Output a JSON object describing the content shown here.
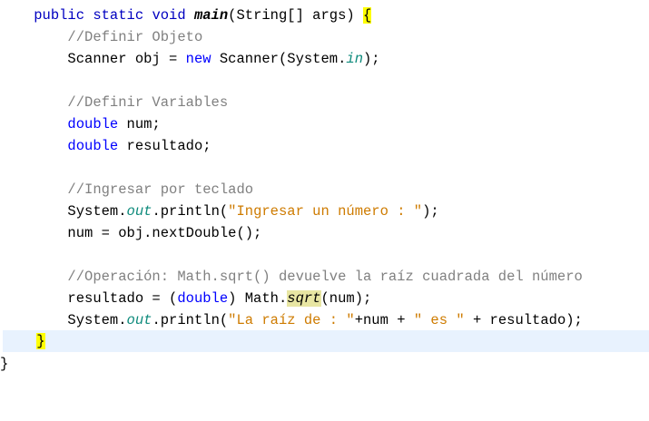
{
  "code": {
    "l1": {
      "indent": "    ",
      "mods": "public static void ",
      "method": "main",
      "params": "(String[] args) ",
      "brace": "{"
    },
    "l2": {
      "indent": "        ",
      "comment": "//Definir Objeto"
    },
    "l3": {
      "indent": "        ",
      "pre": "Scanner obj = ",
      "kw": "new",
      "mid": " Scanner(System.",
      "field": "in",
      "post": ");"
    },
    "l5": {
      "indent": "        ",
      "comment": "//Definir Variables"
    },
    "l6": {
      "indent": "        ",
      "type": "double",
      "rest": " num;"
    },
    "l7": {
      "indent": "        ",
      "type": "double",
      "rest": " resultado;"
    },
    "l9": {
      "indent": "        ",
      "comment": "//Ingresar por teclado"
    },
    "l10": {
      "indent": "        ",
      "pre": "System.",
      "field": "out",
      "mid": ".println(",
      "str": "\"Ingresar un número : \"",
      "post": ");"
    },
    "l11": {
      "indent": "        ",
      "text": "num = obj.nextDouble();"
    },
    "l13": {
      "indent": "        ",
      "comment": "//Operación: Math.sqrt() devuelve la raíz cuadrada del número"
    },
    "l14": {
      "indent": "        ",
      "pre": "resultado = (",
      "type": "double",
      "mid": ") Math.",
      "method": "sqrt",
      "post": "(num);"
    },
    "l15": {
      "indent": "        ",
      "pre": "System.",
      "field": "out",
      "mid": ".println(",
      "str1": "\"La raíz de : \"",
      "op1": "+num + ",
      "str2": "\" es \"",
      "post": " + resultado);"
    },
    "l16": {
      "indent": "    ",
      "brace": "}"
    },
    "l17": {
      "brace": "}"
    }
  }
}
